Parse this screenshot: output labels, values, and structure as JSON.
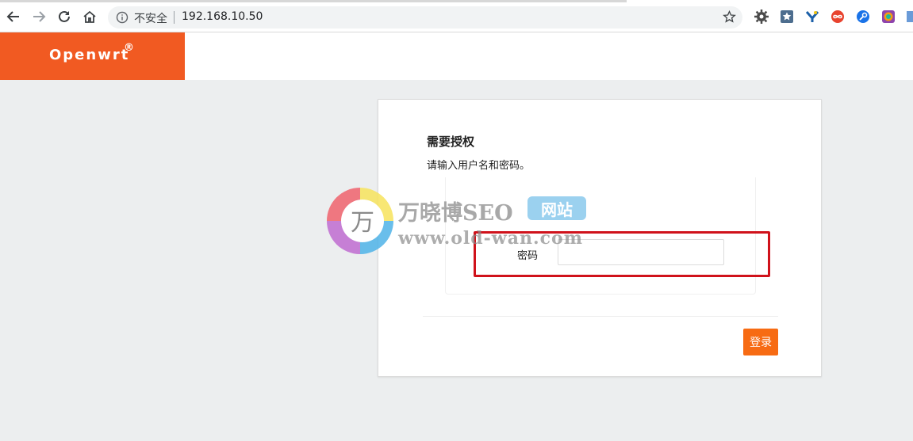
{
  "browser": {
    "security_label": "不安全",
    "url": "192.168.10.50"
  },
  "brand": {
    "name": "Openwrt",
    "reg": "®",
    "accent": "#f15a22"
  },
  "login": {
    "title": "需要授权",
    "subtitle": "请输入用户名和密码。",
    "password_label": "密码",
    "password_value": "",
    "submit_label": "登录",
    "button_color": "#f76b13"
  },
  "annotation": {
    "color": "#d0121b"
  },
  "watermark": {
    "logo_char": "万",
    "brand": "万晓博SEO",
    "badge": "网站",
    "url": "www.old-wan.com"
  }
}
